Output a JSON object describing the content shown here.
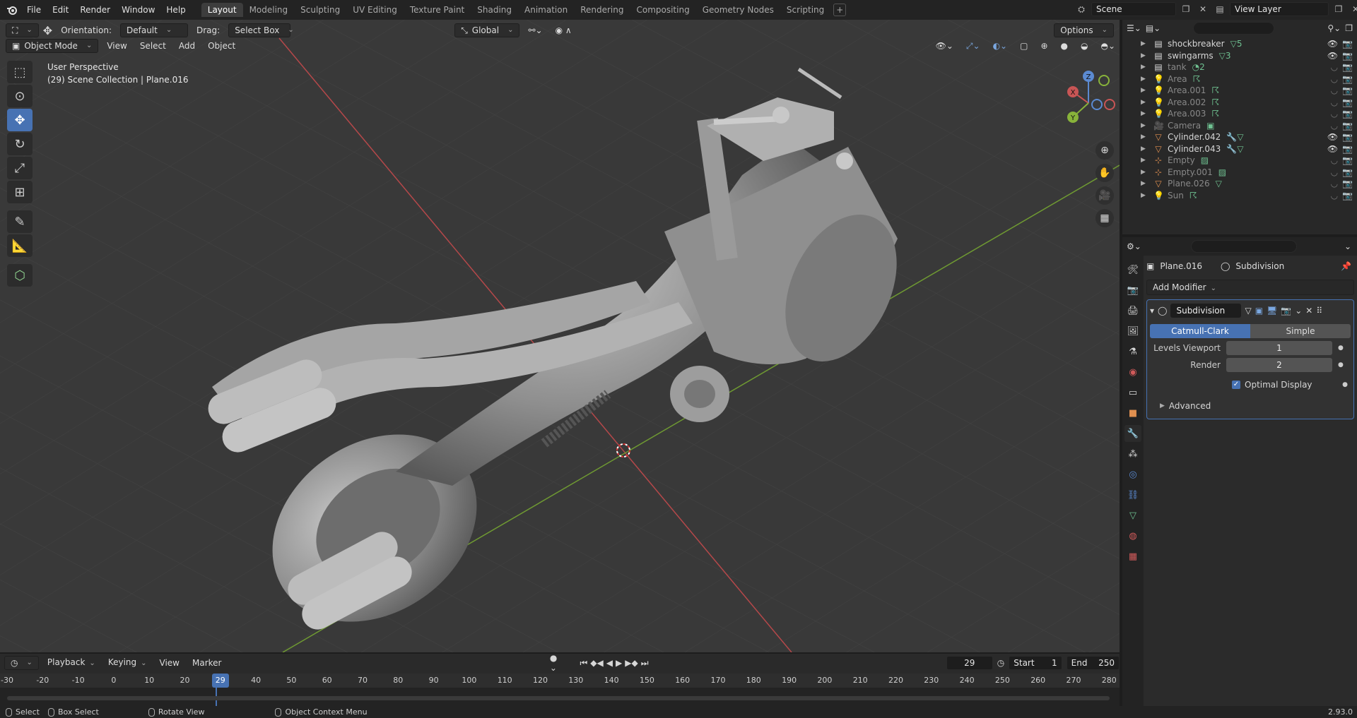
{
  "menu": {
    "items": [
      "File",
      "Edit",
      "Render",
      "Window",
      "Help"
    ]
  },
  "workspaces": [
    {
      "label": "Layout",
      "active": true
    },
    {
      "label": "Modeling"
    },
    {
      "label": "Sculpting"
    },
    {
      "label": "UV Editing"
    },
    {
      "label": "Texture Paint"
    },
    {
      "label": "Shading"
    },
    {
      "label": "Animation"
    },
    {
      "label": "Rendering"
    },
    {
      "label": "Compositing"
    },
    {
      "label": "Geometry Nodes"
    },
    {
      "label": "Scripting"
    }
  ],
  "scene": {
    "name": "Scene",
    "view_layer": "View Layer"
  },
  "viewport_header": {
    "mode": "Object Mode",
    "view": "View",
    "select": "Select",
    "add": "Add",
    "object": "Object",
    "orientation_label": "Orientation:",
    "orientation_value": "Default",
    "drag_label": "Drag:",
    "drag_value": "Select Box",
    "transform": "Global",
    "options": "Options"
  },
  "viewport_info": {
    "line1": "User Perspective",
    "line2": "(29) Scene Collection | Plane.016"
  },
  "gizmo": {
    "x": "X",
    "y": "Y",
    "z": "Z"
  },
  "outliner": {
    "search_placeholder": "",
    "rows": [
      {
        "name": "shockbreaker",
        "icon": "collection-icon",
        "sub": "▽5",
        "dim": false
      },
      {
        "name": "swingarms",
        "icon": "collection-icon",
        "sub": "▽3",
        "dim": false
      },
      {
        "name": "tank",
        "icon": "collection-icon",
        "sub": "◔2",
        "dim": true
      },
      {
        "name": "Area",
        "icon": "light-icon",
        "sub": "☈",
        "dim": true
      },
      {
        "name": "Area.001",
        "icon": "light-icon",
        "sub": "☈",
        "dim": true
      },
      {
        "name": "Area.002",
        "icon": "light-icon",
        "sub": "☈",
        "dim": true
      },
      {
        "name": "Area.003",
        "icon": "light-icon",
        "sub": "☈",
        "dim": true
      },
      {
        "name": "Camera",
        "icon": "camera-icon",
        "sub": "▣",
        "dim": true
      },
      {
        "name": "Cylinder.042",
        "icon": "mesh-icon",
        "sub": "🔧▽",
        "dim": false
      },
      {
        "name": "Cylinder.043",
        "icon": "mesh-icon",
        "sub": "🔧▽",
        "dim": false
      },
      {
        "name": "Empty",
        "icon": "empty-icon",
        "sub": "▨",
        "dim": true
      },
      {
        "name": "Empty.001",
        "icon": "empty-icon",
        "sub": "▨",
        "dim": true
      },
      {
        "name": "Plane.026",
        "icon": "mesh-icon",
        "sub": "▽",
        "dim": true
      },
      {
        "name": "Sun",
        "icon": "light-icon",
        "sub": "☈",
        "dim": true
      }
    ]
  },
  "properties": {
    "object": "Plane.016",
    "modifier_crumb": "Subdivision",
    "add_modifier": "Add Modifier",
    "modifier": {
      "name": "Subdivision",
      "mode_a": "Catmull-Clark",
      "mode_b": "Simple",
      "levels_viewport_label": "Levels Viewport",
      "levels_viewport": "1",
      "render_label": "Render",
      "render": "2",
      "optimal_display": "Optimal Display",
      "advanced": "Advanced"
    }
  },
  "timeline": {
    "playback": "Playback",
    "keying": "Keying",
    "view": "View",
    "marker": "Marker",
    "current_frame": "29",
    "start_label": "Start",
    "start": "1",
    "end_label": "End",
    "end": "250",
    "ticks": [
      "-30",
      "-20",
      "-10",
      "0",
      "10",
      "20",
      "29",
      "40",
      "50",
      "60",
      "70",
      "80",
      "90",
      "100",
      "110",
      "120",
      "130",
      "140",
      "150",
      "160",
      "170",
      "180",
      "190",
      "200",
      "210",
      "220",
      "230",
      "240",
      "250",
      "260",
      "270",
      "280"
    ]
  },
  "status": {
    "select": "Select",
    "box_select": "Box Select",
    "rotate_view": "Rotate View",
    "context_menu": "Object Context Menu",
    "version": "2.93.0"
  },
  "colors": {
    "accent": "#4772b3",
    "x_axis": "#c24a4a",
    "y_axis": "#7aa834",
    "bg_viewport": "#393939"
  }
}
